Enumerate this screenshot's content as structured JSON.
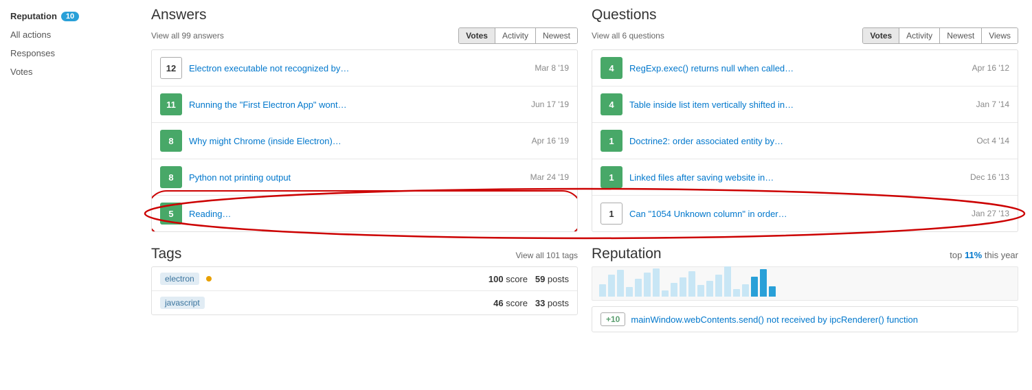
{
  "sidebar": {
    "items": [
      {
        "label": "Reputation",
        "badge": "10",
        "hasBadge": true
      },
      {
        "label": "All actions",
        "hasBadge": false
      },
      {
        "label": "Responses",
        "hasBadge": false
      },
      {
        "label": "Votes",
        "hasBadge": false
      }
    ]
  },
  "answers": {
    "title": "Answers",
    "view_all": "View all 99 answers",
    "tabs": [
      "Votes",
      "Activity",
      "Newest"
    ],
    "active_tab": "Votes",
    "items": [
      {
        "score": 12,
        "answered": false,
        "title": "Electron executable not recognized by…",
        "date": "Mar 8 '19"
      },
      {
        "score": 11,
        "answered": true,
        "title": "Running the \"First Electron App\" wont…",
        "date": "Jun 17 '19"
      },
      {
        "score": 8,
        "answered": true,
        "title": "Why might Chrome (inside Electron)…",
        "date": "Apr 16 '19"
      },
      {
        "score": 8,
        "answered": true,
        "title": "Python not printing output",
        "date": "Mar 24 '19"
      },
      {
        "score": 5,
        "answered": true,
        "title": "Reading…",
        "date": "",
        "highlighted": true
      }
    ]
  },
  "questions": {
    "title": "Questions",
    "view_all": "View all 6 questions",
    "tabs": [
      "Votes",
      "Activity",
      "Newest",
      "Views"
    ],
    "active_tab": "Votes",
    "items": [
      {
        "score": 4,
        "answered": true,
        "title": "RegExp.exec() returns null when called…",
        "date": "Apr 16 '12"
      },
      {
        "score": 4,
        "answered": true,
        "title": "Table inside list item vertically shifted in…",
        "date": "Jan 7 '14"
      },
      {
        "score": 1,
        "answered": true,
        "title": "Doctrine2: order associated entity by…",
        "date": "Oct 4 '14"
      },
      {
        "score": 1,
        "answered": true,
        "title": "Linked files after saving website in…",
        "date": "Dec 16 '13"
      },
      {
        "score": 1,
        "answered": false,
        "title": "Can \"1054 Unknown column\" in order…",
        "date": "Jan 27 '13",
        "highlighted": true
      }
    ]
  },
  "tags": {
    "title": "Tags",
    "view_all": "View all 101 tags",
    "items": [
      {
        "tag": "electron",
        "hasDot": true,
        "score": 100,
        "posts": 59
      },
      {
        "tag": "javascript",
        "hasDot": false,
        "score": 46,
        "posts": 33
      }
    ]
  },
  "reputation": {
    "title": "Reputation",
    "top_text": "top 11% this year",
    "bars": [
      20,
      35,
      42,
      15,
      28,
      38,
      45,
      10,
      22,
      30,
      40,
      18,
      25,
      35,
      48,
      12,
      20,
      32,
      44,
      16
    ],
    "item": {
      "badge": "+10",
      "title": "mainWindow.webContents.send() not received by ipcRenderer() function"
    }
  }
}
